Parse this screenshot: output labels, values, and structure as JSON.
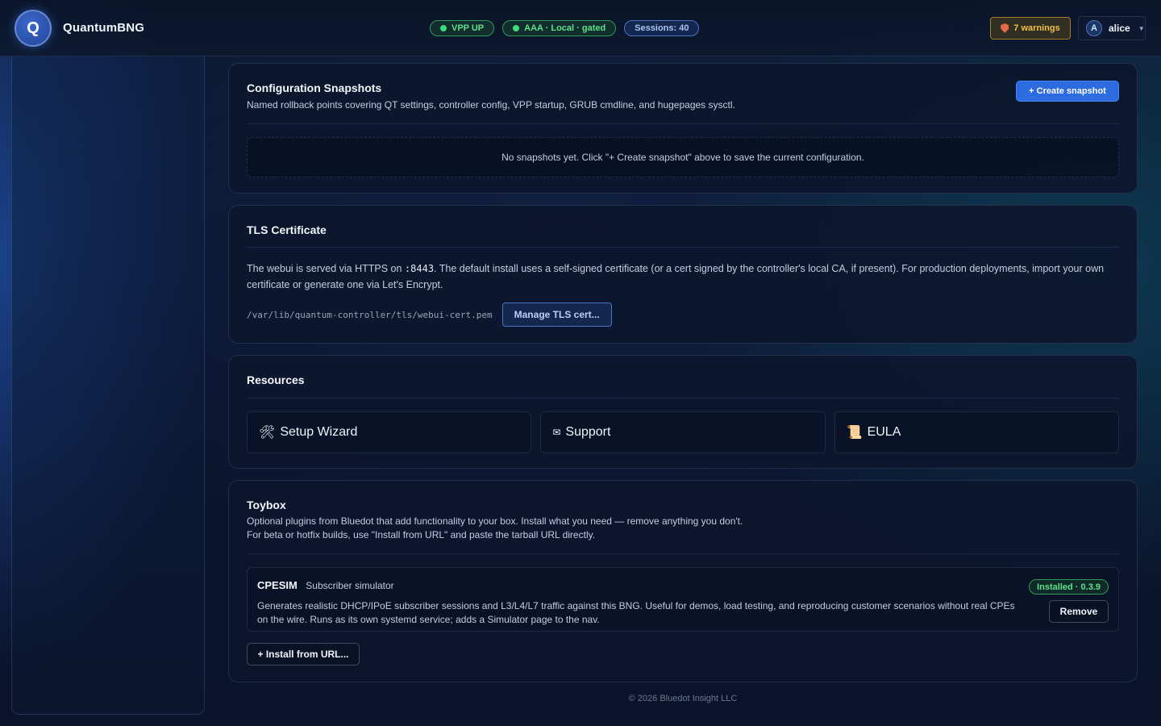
{
  "header": {
    "logo_letter": "Q",
    "brand": "QuantumBNG",
    "status": {
      "vpp": "VPP UP",
      "aaa": "AAA · Local · gated",
      "sessions": "Sessions: 40"
    },
    "warnings": "7 warnings",
    "user": {
      "initial": "A",
      "name": "alice"
    }
  },
  "snapshots": {
    "title": "Configuration Snapshots",
    "subtitle": "Named rollback points covering QT settings, controller config, VPP startup, GRUB cmdline, and hugepages sysctl.",
    "create_label": "+ Create snapshot",
    "empty_text": "No snapshots yet. Click \"+ Create snapshot\" above to save the current configuration."
  },
  "tls": {
    "title": "TLS Certificate",
    "desc_before": "The webui is served via HTTPS on ",
    "port": ":8443",
    "desc_after": ". The default install uses a self-signed certificate (or a cert signed by the controller's local CA, if present). For production deployments, import your own certificate or generate one via Let's Encrypt.",
    "cert_path": "/var/lib/quantum-controller/tls/webui-cert.pem",
    "manage_label": "Manage TLS cert..."
  },
  "resources": {
    "title": "Resources",
    "items": [
      {
        "icon": "🛠",
        "label": "Setup Wizard"
      },
      {
        "icon": "✉",
        "label": "Support"
      },
      {
        "icon": "📜",
        "label": "EULA"
      }
    ]
  },
  "toybox": {
    "title": "Toybox",
    "line1": "Optional plugins from Bluedot that add functionality to your box. Install what you need — remove anything you don't.",
    "line2": "For beta or hotfix builds, use \"Install from URL\" and paste the tarball URL directly.",
    "plugins": [
      {
        "name": "CPESIM",
        "tagline": "Subscriber simulator",
        "description": "Generates realistic DHCP/IPoE subscriber sessions and L3/L4/L7 traffic against this BNG. Useful for demos, load testing, and reproducing customer scenarios without real CPEs on the wire. Runs as its own systemd service; adds a Simulator page to the nav.",
        "status": "Installed · 0.3.9",
        "action": "Remove"
      }
    ],
    "install_url_label": "+ Install from URL..."
  },
  "footer": "© 2026 Bluedot Insight LLC",
  "colors": {
    "accent": "#2d6be0",
    "success": "#3ddc78",
    "warning": "#f2c14d",
    "background": "#0b1630"
  }
}
